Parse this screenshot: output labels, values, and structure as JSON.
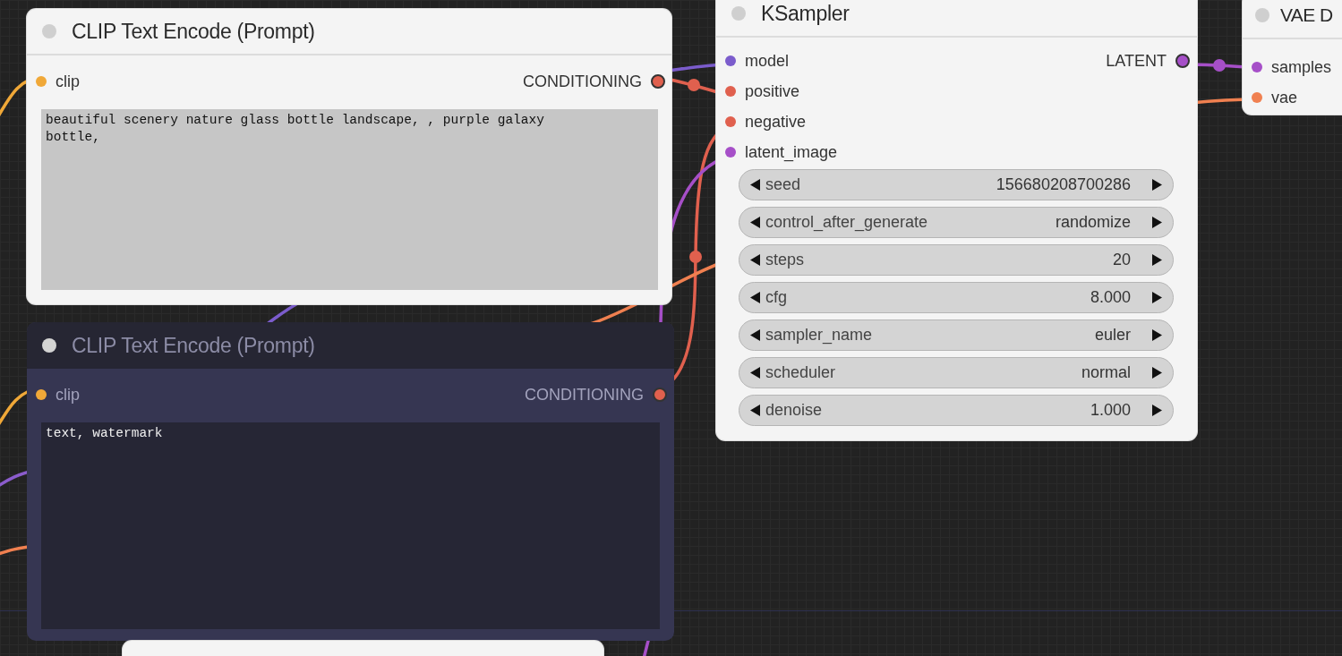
{
  "nodes": [
    {
      "title": "CLIP Text Encode (Prompt)",
      "bypassed": false,
      "inputs": [
        {
          "name": "clip",
          "color": "#f0a838"
        }
      ],
      "outputs": [
        {
          "name": "CONDITIONING",
          "color": "#e0604e"
        }
      ],
      "text": "beautiful scenery nature glass bottle landscape, , purple galaxy bottle,"
    },
    {
      "title": "CLIP Text Encode (Prompt)",
      "bypassed": true,
      "inputs": [
        {
          "name": "clip",
          "color": "#f0a838"
        }
      ],
      "outputs": [
        {
          "name": "CONDITIONING",
          "color": "#e0604e"
        }
      ],
      "text": "text, watermark"
    },
    {
      "title": "KSampler",
      "bypassed": false,
      "inputs": [
        {
          "name": "model",
          "color": "#7b5ccc"
        },
        {
          "name": "positive",
          "color": "#e0604e"
        },
        {
          "name": "negative",
          "color": "#e0604e"
        },
        {
          "name": "latent_image",
          "color": "#a64fc8"
        }
      ],
      "outputs": [
        {
          "name": "LATENT",
          "color": "#a64fc8"
        }
      ],
      "widgets": [
        {
          "name": "seed",
          "value": "156680208700286"
        },
        {
          "name": "control_after_generate",
          "value": "randomize"
        },
        {
          "name": "steps",
          "value": "20"
        },
        {
          "name": "cfg",
          "value": "8.000"
        },
        {
          "name": "sampler_name",
          "value": "euler"
        },
        {
          "name": "scheduler",
          "value": "normal"
        },
        {
          "name": "denoise",
          "value": "1.000"
        }
      ]
    },
    {
      "title": "VAE D",
      "bypassed": false,
      "inputs": [
        {
          "name": "samples",
          "color": "#a64fc8"
        },
        {
          "name": "vae",
          "color": "#f08050"
        }
      ]
    },
    {
      "bypassed": false
    }
  ]
}
